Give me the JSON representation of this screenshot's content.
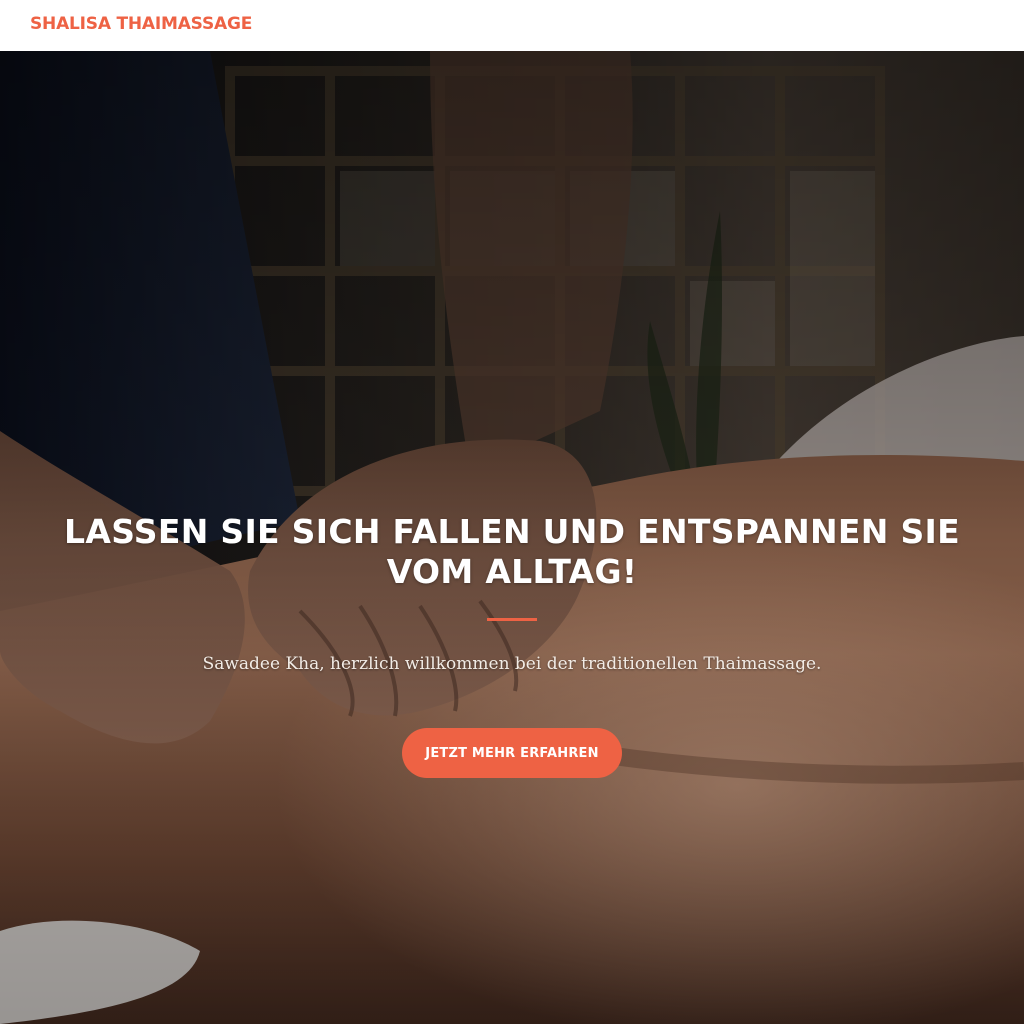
{
  "theme": {
    "accent": "#ee6244"
  },
  "header": {
    "brand": "SHALISA THAIMASSAGE"
  },
  "hero": {
    "title": "LASSEN SIE SICH FALLEN UND ENTSPANNEN SIE VOM ALLTAG!",
    "subtitle": "Sawadee Kha, herzlich willkommen bei der traditionellen Thaimassage.",
    "cta_label": "JETZT MEHR ERFAHREN",
    "background_image": "massage-hands-on-back-photo"
  }
}
